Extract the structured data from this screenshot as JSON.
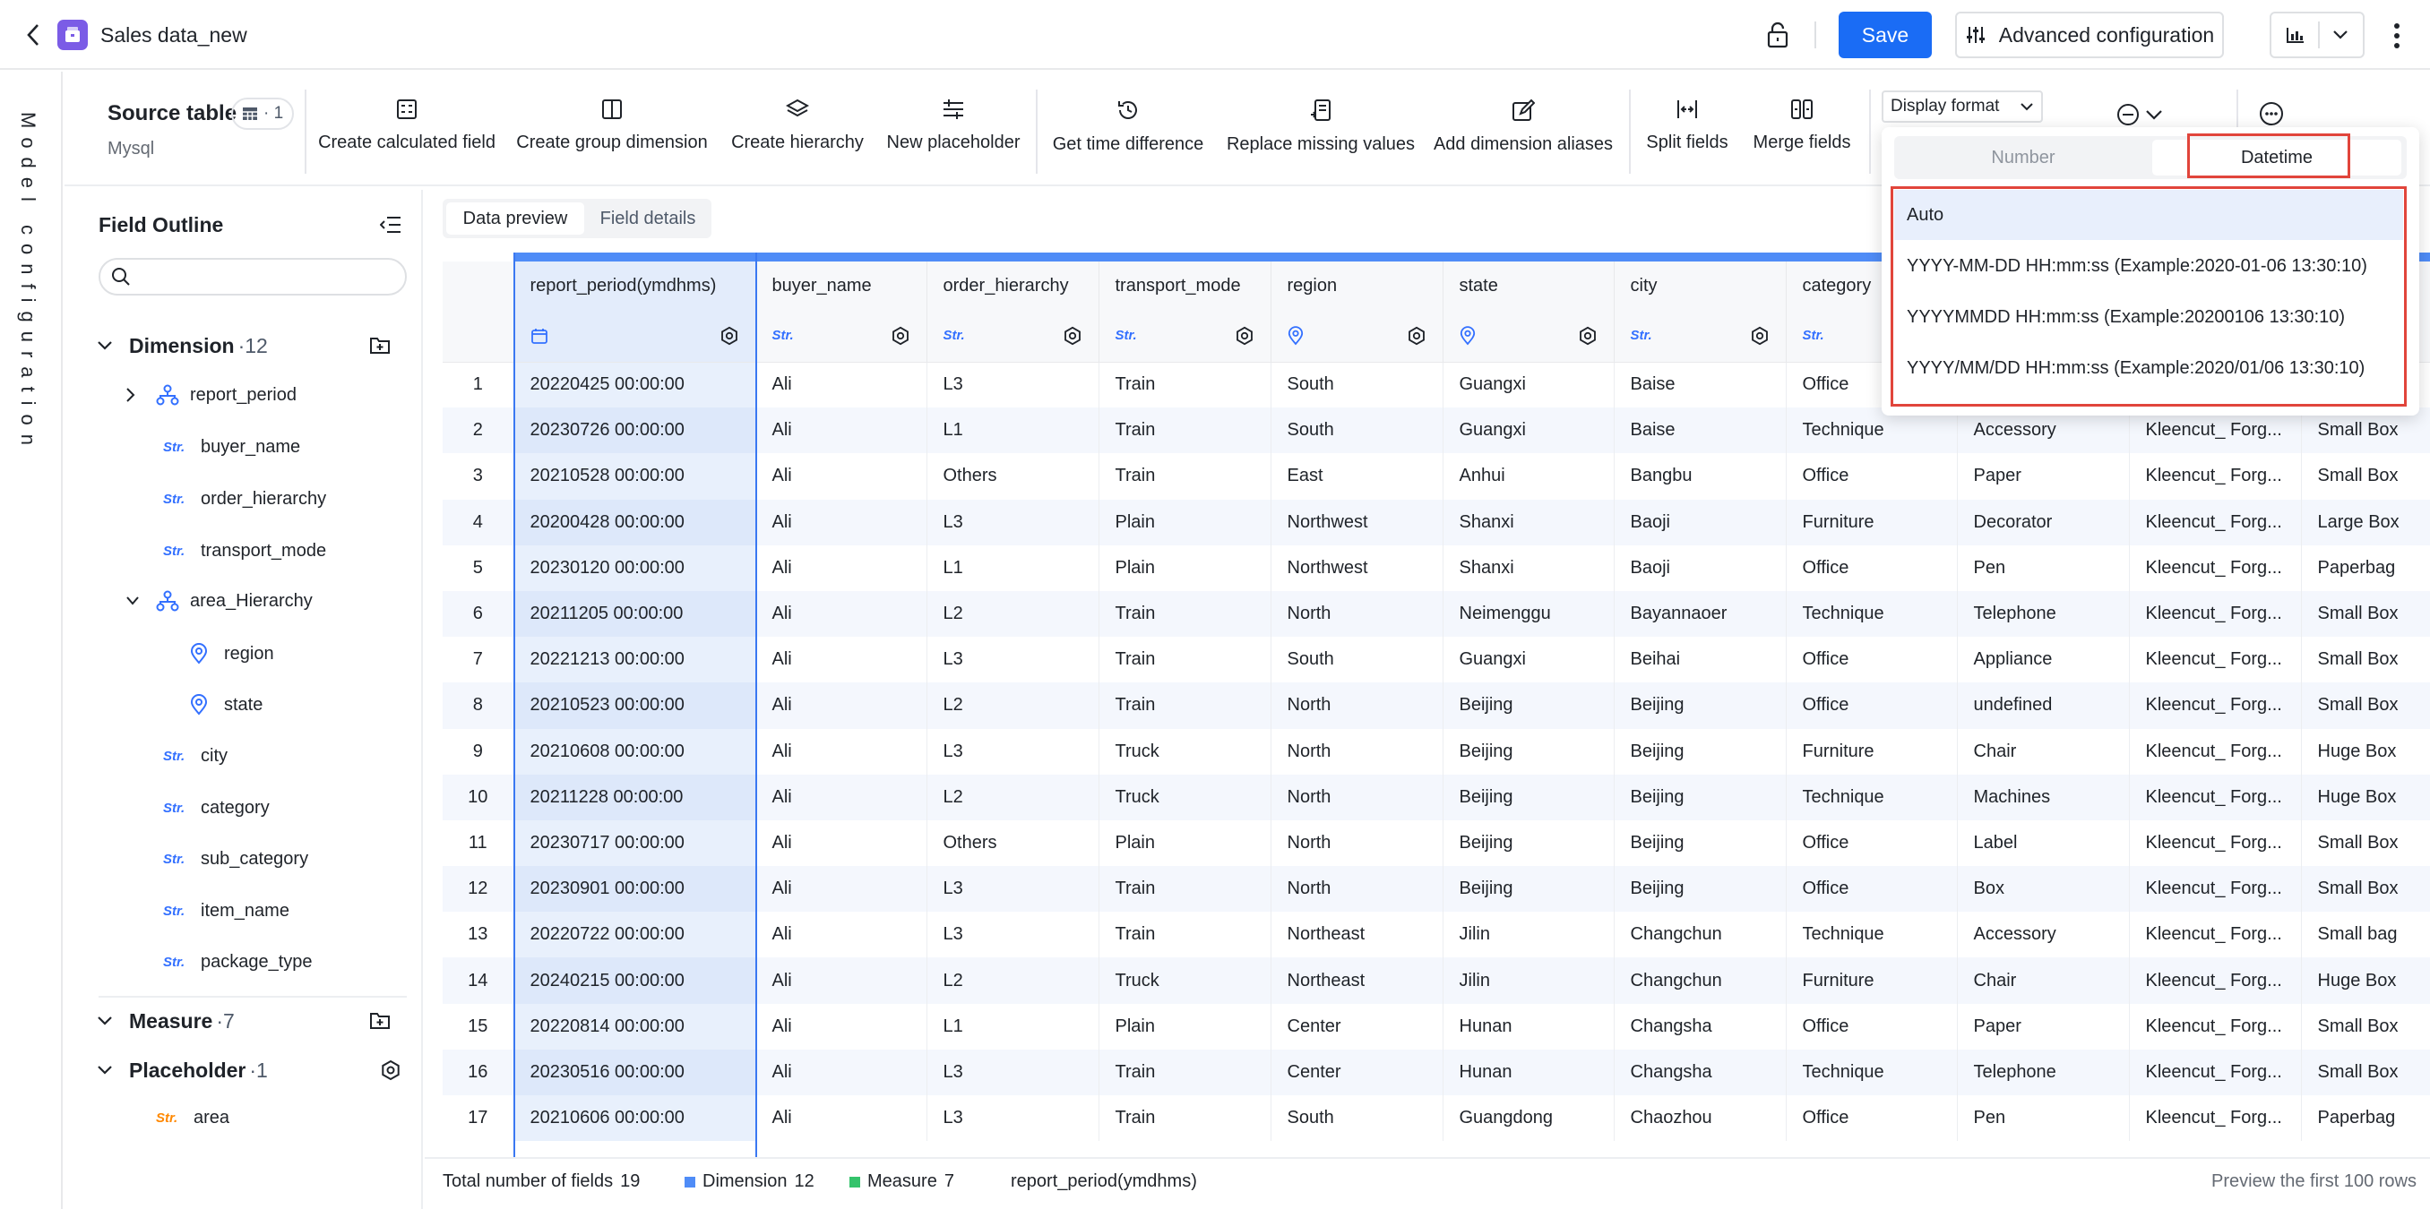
{
  "header": {
    "title": "Sales data_new",
    "save_label": "Save",
    "advanced_label": "Advanced configuration"
  },
  "rail": {
    "label": "Model configuration"
  },
  "source": {
    "title": "Source table",
    "badge_count": "· 1",
    "db": "Mysql"
  },
  "toolbar": {
    "tools": [
      "Create calculated field",
      "Create group dimension",
      "Create hierarchy",
      "New placeholder",
      "Get time difference",
      "Replace missing values",
      "Add dimension aliases",
      "Split fields",
      "Merge fields"
    ],
    "display_format": "Display format"
  },
  "outline": {
    "title": "Field Outline",
    "dimension": {
      "label": "Dimension",
      "count": "·12"
    },
    "fields": [
      {
        "type": "",
        "name": "report_period"
      },
      {
        "type": "Str.",
        "name": "buyer_name"
      },
      {
        "type": "Str.",
        "name": "order_hierarchy"
      },
      {
        "type": "Str.",
        "name": "transport_mode"
      },
      {
        "type": "",
        "name": "area_Hierarchy"
      },
      {
        "type": "",
        "name": "region"
      },
      {
        "type": "",
        "name": "state"
      },
      {
        "type": "Str.",
        "name": "city"
      },
      {
        "type": "Str.",
        "name": "category"
      },
      {
        "type": "Str.",
        "name": "sub_category"
      },
      {
        "type": "Str.",
        "name": "item_name"
      },
      {
        "type": "Str.",
        "name": "package_type"
      }
    ],
    "measure": {
      "label": "Measure",
      "count": "·7"
    },
    "placeholder": {
      "label": "Placeholder",
      "count": "·1"
    },
    "placeholder_field": {
      "type": "Str.",
      "name": "area"
    }
  },
  "tabs": {
    "preview": "Data preview",
    "details": "Field details"
  },
  "table": {
    "columns": [
      "report_period(ymdhms)",
      "buyer_name",
      "order_hierarchy",
      "transport_mode",
      "region",
      "state",
      "city",
      "category",
      "",
      "",
      ""
    ],
    "subtypes": [
      "",
      "Str.",
      "Str.",
      "Str.",
      "",
      "",
      "Str.",
      "Str.",
      "",
      "",
      ""
    ],
    "rows": [
      [
        "1",
        "20220425 00:00:00",
        "Ali",
        "L3",
        "Train",
        "South",
        "Guangxi",
        "Baise",
        "Office",
        "",
        "",
        ""
      ],
      [
        "2",
        "20230726 00:00:00",
        "Ali",
        "L1",
        "Train",
        "South",
        "Guangxi",
        "Baise",
        "Technique",
        "Accessory",
        "Kleencut_ Forg...",
        "Small Box"
      ],
      [
        "3",
        "20210528 00:00:00",
        "Ali",
        "Others",
        "Train",
        "East",
        "Anhui",
        "Bangbu",
        "Office",
        "Paper",
        "Kleencut_ Forg...",
        "Small Box"
      ],
      [
        "4",
        "20200428 00:00:00",
        "Ali",
        "L3",
        "Plain",
        "Northwest",
        "Shanxi",
        "Baoji",
        "Furniture",
        "Decorator",
        "Kleencut_ Forg...",
        "Large Box"
      ],
      [
        "5",
        "20230120 00:00:00",
        "Ali",
        "L1",
        "Plain",
        "Northwest",
        "Shanxi",
        "Baoji",
        "Office",
        "Pen",
        "Kleencut_ Forg...",
        "Paperbag"
      ],
      [
        "6",
        "20211205 00:00:00",
        "Ali",
        "L2",
        "Train",
        "North",
        "Neimenggu",
        "Bayannaoer",
        "Technique",
        "Telephone",
        "Kleencut_ Forg...",
        "Small Box"
      ],
      [
        "7",
        "20221213 00:00:00",
        "Ali",
        "L3",
        "Train",
        "South",
        "Guangxi",
        "Beihai",
        "Office",
        "Appliance",
        "Kleencut_ Forg...",
        "Small Box"
      ],
      [
        "8",
        "20210523 00:00:00",
        "Ali",
        "L2",
        "Train",
        "North",
        "Beijing",
        "Beijing",
        "Office",
        "undefined",
        "Kleencut_ Forg...",
        "Small Box"
      ],
      [
        "9",
        "20210608 00:00:00",
        "Ali",
        "L3",
        "Truck",
        "North",
        "Beijing",
        "Beijing",
        "Furniture",
        "Chair",
        "Kleencut_ Forg...",
        "Huge Box"
      ],
      [
        "10",
        "20211228 00:00:00",
        "Ali",
        "L2",
        "Truck",
        "North",
        "Beijing",
        "Beijing",
        "Technique",
        "Machines",
        "Kleencut_ Forg...",
        "Huge Box"
      ],
      [
        "11",
        "20230717 00:00:00",
        "Ali",
        "Others",
        "Plain",
        "North",
        "Beijing",
        "Beijing",
        "Office",
        "Label",
        "Kleencut_ Forg...",
        "Small Box"
      ],
      [
        "12",
        "20230901 00:00:00",
        "Ali",
        "L3",
        "Train",
        "North",
        "Beijing",
        "Beijing",
        "Office",
        "Box",
        "Kleencut_ Forg...",
        "Small Box"
      ],
      [
        "13",
        "20220722 00:00:00",
        "Ali",
        "L3",
        "Train",
        "Northeast",
        "Jilin",
        "Changchun",
        "Technique",
        "Accessory",
        "Kleencut_ Forg...",
        "Small bag"
      ],
      [
        "14",
        "20240215 00:00:00",
        "Ali",
        "L2",
        "Truck",
        "Northeast",
        "Jilin",
        "Changchun",
        "Furniture",
        "Chair",
        "Kleencut_ Forg...",
        "Huge Box"
      ],
      [
        "15",
        "20220814 00:00:00",
        "Ali",
        "L1",
        "Plain",
        "Center",
        "Hunan",
        "Changsha",
        "Office",
        "Paper",
        "Kleencut_ Forg...",
        "Small Box"
      ],
      [
        "16",
        "20230516 00:00:00",
        "Ali",
        "L3",
        "Train",
        "Center",
        "Hunan",
        "Changsha",
        "Technique",
        "Telephone",
        "Kleencut_ Forg...",
        "Small Box"
      ],
      [
        "17",
        "20210606 00:00:00",
        "Ali",
        "L3",
        "Train",
        "South",
        "Guangdong",
        "Chaozhou",
        "Office",
        "Pen",
        "Kleencut_ Forg...",
        "Paperbag"
      ]
    ]
  },
  "footer": {
    "total_label": "Total number of fields",
    "total_value": "19",
    "dimension_label": "Dimension",
    "dimension_value": "12",
    "measure_label": "Measure",
    "measure_value": "7",
    "selected_field": "report_period(ymdhms)",
    "preview_note": "Preview the first 100 rows"
  },
  "format_dropdown": {
    "tabs": [
      "Number",
      "Datetime"
    ],
    "selected_tab": "Datetime",
    "options": [
      "Auto",
      "YYYY-MM-DD HH:mm:ss (Example:2020-01-06 13:30:10)",
      "YYYYMMDD HH:mm:ss (Example:20200106 13:30:10)",
      "YYYY/MM/DD HH:mm:ss (Example:2020/01/06 13:30:10)"
    ],
    "selected_option": "Auto"
  },
  "colors": {
    "accent": "#1a6cf5",
    "highlight": "#e1453b",
    "dimension": "#4f8cf7",
    "measure": "#34c36b",
    "logo": "#7b5ce6"
  }
}
